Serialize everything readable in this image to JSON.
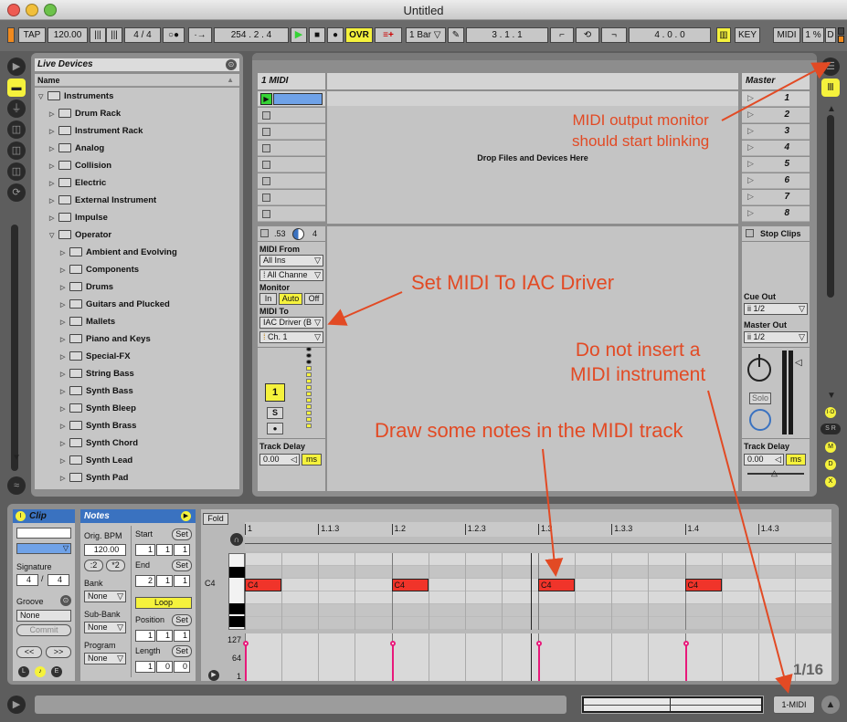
{
  "window": {
    "title": "Untitled"
  },
  "control_bar": {
    "tap": "TAP",
    "tempo": "120.00",
    "signature": "4 / 4",
    "dots": "○●",
    "link": "·→",
    "position": "254 . 2 . 4",
    "ovr": "OVR",
    "quantize": "1 Bar",
    "loop_start": "3 . 1 . 1",
    "loop_length": "4 . 0 . 0",
    "key": "KEY",
    "midi": "MIDI",
    "cpu": "1 %",
    "disk": "D"
  },
  "browser": {
    "title": "Live Devices",
    "column": "Name",
    "items": [
      {
        "label": "Instruments",
        "level": 0,
        "open": true
      },
      {
        "label": "Drum Rack",
        "level": 1
      },
      {
        "label": "Instrument Rack",
        "level": 1
      },
      {
        "label": "Analog",
        "level": 1
      },
      {
        "label": "Collision",
        "level": 1
      },
      {
        "label": "Electric",
        "level": 1
      },
      {
        "label": "External Instrument",
        "level": 1
      },
      {
        "label": "Impulse",
        "level": 1
      },
      {
        "label": "Operator",
        "level": 1,
        "open": true
      },
      {
        "label": "Ambient and Evolving",
        "level": 2
      },
      {
        "label": "Components",
        "level": 2
      },
      {
        "label": "Drums",
        "level": 2
      },
      {
        "label": "Guitars and Plucked",
        "level": 2
      },
      {
        "label": "Mallets",
        "level": 2
      },
      {
        "label": "Piano and Keys",
        "level": 2
      },
      {
        "label": "Special-FX",
        "level": 2
      },
      {
        "label": "String Bass",
        "level": 2
      },
      {
        "label": "Synth Bass",
        "level": 2
      },
      {
        "label": "Synth Bleep",
        "level": 2
      },
      {
        "label": "Synth Brass",
        "level": 2
      },
      {
        "label": "Synth Chord",
        "level": 2
      },
      {
        "label": "Synth Lead",
        "level": 2
      },
      {
        "label": "Synth Pad",
        "level": 2
      }
    ]
  },
  "session": {
    "track_name": "1 MIDI",
    "master_name": "Master",
    "drop_hint": "Drop Files and Devices Here",
    "scenes": [
      "1",
      "2",
      "3",
      "4",
      "5",
      "6",
      "7",
      "8"
    ],
    "stop_clips": "Stop Clips",
    "track_io": {
      "vol": ".53",
      "pan": "4",
      "midi_from_label": "MIDI From",
      "midi_from": "All Ins",
      "channel_from": "All Channe",
      "monitor_label": "Monitor",
      "monitor_in": "In",
      "monitor_auto": "Auto",
      "monitor_off": "Off",
      "midi_to_label": "MIDI To",
      "midi_to": "IAC Driver (B",
      "channel_to": "Ch. 1",
      "track_number": "1",
      "solo": "S",
      "arm": "●",
      "track_delay_label": "Track Delay",
      "track_delay": "0.00",
      "unit": "ms"
    },
    "master_io": {
      "cue_out_label": "Cue Out",
      "cue_out": "ii 1/2",
      "master_out_label": "Master Out",
      "master_out": "ii 1/2",
      "solo": "Solo",
      "track_delay_label": "Track Delay",
      "track_delay": "0.00",
      "unit": "ms"
    }
  },
  "clip": {
    "clip_label": "Clip",
    "notes_label": "Notes",
    "signature_label": "Signature",
    "sig_num": "4",
    "sig_den": "4",
    "groove_label": "Groove",
    "groove": "None",
    "commit": "Commit",
    "nudge_left": "<<",
    "nudge_right": ">>",
    "orig_bpm_label": "Orig. BPM",
    "orig_bpm": "120.00",
    "half": ":2",
    "double": "*2",
    "bank_label": "Bank",
    "bank": "None",
    "subbank_label": "Sub-Bank",
    "subbank": "None",
    "program_label": "Program",
    "program": "None",
    "start_label": "Start",
    "set": "Set",
    "start": [
      "1",
      "1",
      "1"
    ],
    "end_label": "End",
    "end": [
      "2",
      "1",
      "1"
    ],
    "loop": "Loop",
    "position_label": "Position",
    "position": [
      "1",
      "1",
      "1"
    ],
    "length_label": "Length",
    "length": [
      "1",
      "0",
      "0"
    ],
    "fold": "Fold",
    "ruler": [
      "1",
      "1.1.3",
      "1.2",
      "1.2.3",
      "1.3",
      "1.3.3",
      "1.4",
      "1.4.3"
    ],
    "pitch_label": "C4",
    "notes": [
      {
        "label": "C4",
        "beat": 0
      },
      {
        "label": "C4",
        "beat": 1
      },
      {
        "label": "C4",
        "beat": 2
      },
      {
        "label": "C4",
        "beat": 3
      }
    ],
    "velocity_labels": [
      "127",
      "64",
      "1"
    ],
    "grid": "1/16"
  },
  "status": {
    "track_button": "1-MIDI"
  },
  "annotations": {
    "midi_monitor": "MIDI output monitor\nshould start blinking",
    "set_midi": "Set MIDI To IAC Driver",
    "no_instrument": "Do not insert a\nMIDI instrument",
    "draw_notes": "Draw some notes in the MIDI track"
  },
  "colors": {
    "accent_yellow": "#f5f23c",
    "note_red": "#f0342a",
    "annotation": "#e24a24",
    "play_green": "#35d335"
  }
}
